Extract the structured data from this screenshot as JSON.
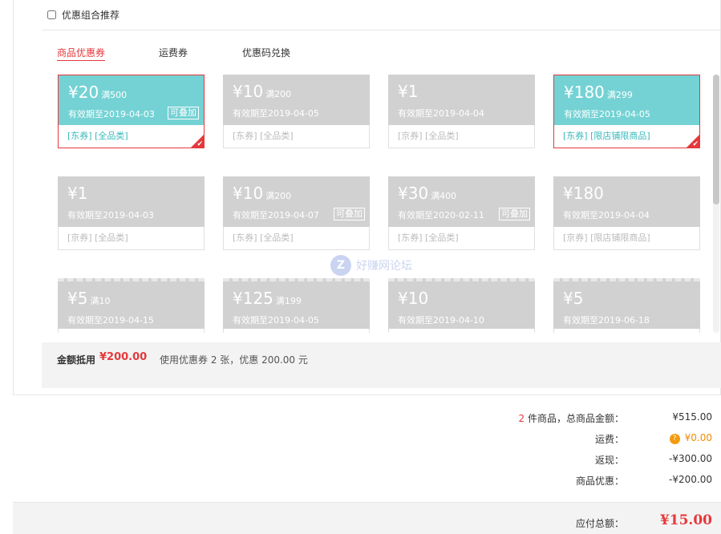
{
  "combo": {
    "label": "优惠组合推荐"
  },
  "tabs": [
    {
      "label": "商品优惠券",
      "active": true
    },
    {
      "label": "运费券",
      "active": false
    },
    {
      "label": "优惠码兑换",
      "active": false
    }
  ],
  "coupons": [
    {
      "amount": "¥20",
      "threshold": "满500",
      "expiry": "有效期至2019-04-03",
      "stackable": "可叠加",
      "scope": "[东券]  [全品类]",
      "selected": true
    },
    {
      "amount": "¥10",
      "threshold": "满200",
      "expiry": "有效期至2019-04-05",
      "stackable": "",
      "scope": "[东券]  [全品类]",
      "selected": false
    },
    {
      "amount": "¥1",
      "threshold": "",
      "expiry": "有效期至2019-04-04",
      "stackable": "",
      "scope": "[京券]  [全品类]",
      "selected": false
    },
    {
      "amount": "¥180",
      "threshold": "满299",
      "expiry": "有效期至2019-04-05",
      "stackable": "",
      "scope": "[东券]  [限店铺限商品]",
      "selected": true
    },
    {
      "amount": "¥1",
      "threshold": "",
      "expiry": "有效期至2019-04-03",
      "stackable": "",
      "scope": "[京券]  [全品类]",
      "selected": false
    },
    {
      "amount": "¥10",
      "threshold": "满200",
      "expiry": "有效期至2019-04-07",
      "stackable": "可叠加",
      "scope": "[东券]  [全品类]",
      "selected": false
    },
    {
      "amount": "¥30",
      "threshold": "满400",
      "expiry": "有效期至2020-02-11",
      "stackable": "可叠加",
      "scope": "[东券]  [全品类]",
      "selected": false
    },
    {
      "amount": "¥180",
      "threshold": "",
      "expiry": "有效期至2019-04-04",
      "stackable": "",
      "scope": "[京券]  [限店铺限商品]",
      "selected": false
    },
    {
      "amount": "¥5",
      "threshold": "满10",
      "expiry": "有效期至2019-04-15",
      "stackable": "",
      "scope": "",
      "selected": false
    },
    {
      "amount": "¥125",
      "threshold": "满199",
      "expiry": "有效期至2019-04-05",
      "stackable": "",
      "scope": "",
      "selected": false
    },
    {
      "amount": "¥10",
      "threshold": "",
      "expiry": "有效期至2019-04-10",
      "stackable": "",
      "scope": "",
      "selected": false
    },
    {
      "amount": "¥5",
      "threshold": "",
      "expiry": "有效期至2019-06-18",
      "stackable": "",
      "scope": "",
      "selected": false
    }
  ],
  "watermark": {
    "logo": "Z",
    "text": "好赚网论坛"
  },
  "summary": {
    "label": "金额抵用",
    "amount": "¥200.00",
    "description": "使用优惠券 2 张，优惠 200.00 元"
  },
  "totals": {
    "count": "2",
    "items_label": "件商品，总商品金额：",
    "items_value": "¥515.00",
    "shipping_label": "运费：",
    "shipping_value": "¥0.00",
    "cashback_label": "返现：",
    "cashback_value": "-¥300.00",
    "discount_label": "商品优惠：",
    "discount_value": "-¥200.00"
  },
  "payable": {
    "label": "应付总额：",
    "value": "¥15.00"
  },
  "colors": {
    "accent": "#e4393c",
    "selected_coupon": "#74d2d4",
    "inactive_coupon": "#d1d1d1",
    "shipping": "#f48a00"
  }
}
